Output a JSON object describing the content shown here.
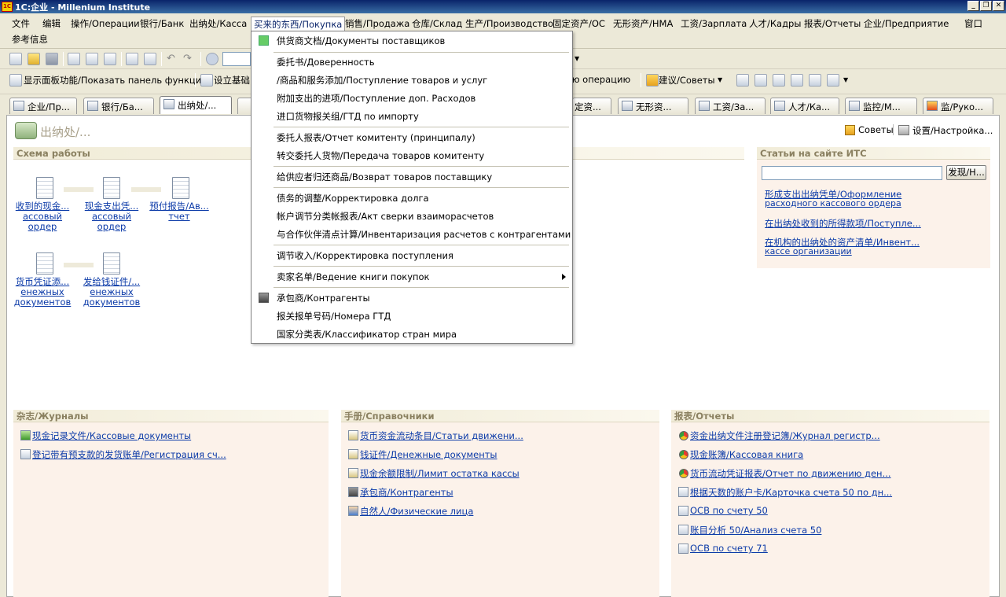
{
  "window": {
    "title": "1С:企业 - Millenium Institute",
    "logo_text": "1С"
  },
  "menubar": {
    "items": [
      "文件",
      "编辑",
      "操作/Операции",
      "银行/Банк",
      "出纳处/Касса",
      "买来的东西/Покупка",
      "销售/Продажа",
      "仓库/Склад",
      "生产/Производство",
      "固定资产/ОС",
      "无形资产/НМА",
      "工资/Зарплата",
      "人才/Кадры",
      "报表/Отчеты",
      "企业/Предприятие",
      "窗口",
      "参考信息"
    ]
  },
  "toolbar2": {
    "show_panel": "显示面板功能/Показать панель функций",
    "setup": "设立基础",
    "operation": "нную операцию",
    "advice": "建议/Советы"
  },
  "tabs": [
    "企业/Пр...",
    "银行/Ба...",
    "出纳处/...",
    "",
    "定资...",
    "无形资...",
    "工资/За...",
    "人才/Ка...",
    "监控/М...",
    "监/Руко..."
  ],
  "page": {
    "title": "出纳处/...",
    "advice_link": "Советы",
    "settings_link": "设置/Настройка..."
  },
  "schema": {
    "header": "Схема работы",
    "nodes": [
      {
        "line1": "收到的现金...",
        "line2": "ассовый",
        "line3": "ордер"
      },
      {
        "line1": "现金支出凭...",
        "line2": "ассовый",
        "line3": "ордер"
      },
      {
        "line1": "预付报告/Ав...",
        "line2": "тчет",
        "line3": ""
      },
      {
        "line1": "货币凭证添...",
        "line2": "енежных",
        "line3": "документов"
      },
      {
        "line1": "发给钱证件/...",
        "line2": "енежных",
        "line3": "документов"
      }
    ]
  },
  "its": {
    "header": "Статьи на сайте ИТС",
    "search_value": "",
    "find_button": "发现/Н...",
    "links": [
      {
        "l1": "形成支出出纳凭单/Оформление",
        "l2": "расходного кассового ордера"
      },
      {
        "l1": "在出纳处收到的所得款项/Поступле...",
        "l2": ""
      },
      {
        "l1": "在机构的出纳处的资产清单/Инвент...",
        "l2": " кассе организации"
      }
    ]
  },
  "journals": {
    "header": "杂志/Журналы",
    "items": [
      "现金记录文件/Кассовые документы",
      "登记带有预支款的发货账单/Регистрация сч..."
    ]
  },
  "references": {
    "header": "手册/Справочники",
    "items": [
      "货币资金流动条目/Статьи движени...",
      "钱证件/Денежные документы",
      "现金余额限制/Лимит остатка кассы",
      "承包商/Контрагенты",
      "自然人/Физические лица"
    ]
  },
  "reports": {
    "header": "报表/Отчеты",
    "items": [
      "资金出纳文件注册登记簿/Журнал регистр...",
      "现金账簿/Кассовая книга",
      "货币流动凭证报表/Отчет по движению ден...",
      "根据天数的账户卡/Карточка счета 50 по дн...",
      "ОСВ по счету 50",
      "账目分析 50/Анализ счета 50",
      "ОСВ по счету 71"
    ]
  },
  "dropdown": {
    "items": [
      "供货商文档/Документы поставщиков",
      "委托书/Доверенность",
      "/商品和服务添加/Поступление товаров и услуг",
      "附加支出的进项/Поступление доп. Расходов",
      "进口货物报关组/ГТД по импорту",
      "委托人报表/Отчет комитенту (принципалу)",
      "转交委托人货物/Передача товаров комитенту",
      "给供应者归还商品/Возврат товаров поставщику",
      "债务的调整/Корректировка долга",
      "帐户调节分类帐报表/Акт сверки взаиморасчетов",
      "与合作伙伴清点计算/Инвентаризация расчетов с контрагентами",
      "调节收入/Корректировка поступления",
      "卖家名单/Ведение книги покупок",
      "承包商/Контрагенты",
      "报关报单号码/Номера ГТД",
      "国家分类表/Классификатор стран мира"
    ]
  }
}
